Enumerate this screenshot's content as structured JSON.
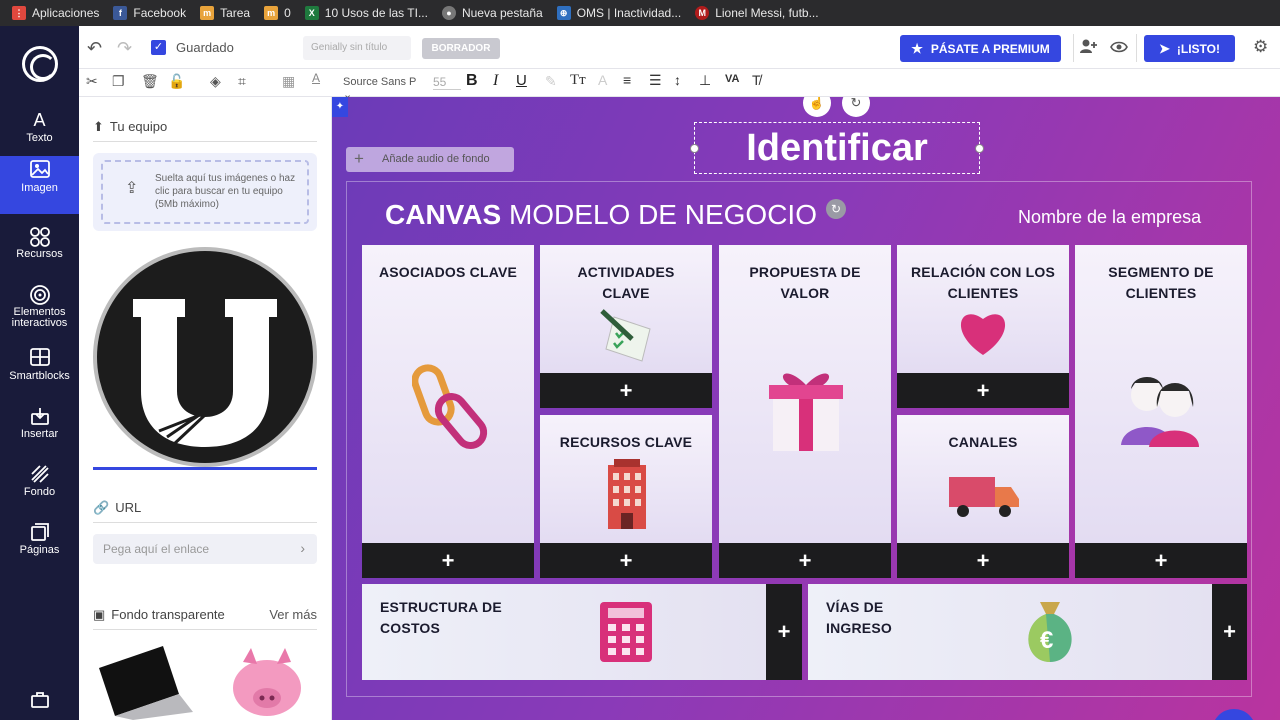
{
  "bookmarks": [
    {
      "label": "Aplicaciones",
      "color": "#e0483e"
    },
    {
      "label": "Facebook",
      "color": "#3b5998"
    },
    {
      "label": "Tarea",
      "color": "#e8a33b"
    },
    {
      "label": "0",
      "color": "#e8a33b"
    },
    {
      "label": "10 Usos de las TI...",
      "color": "#1f7a3e"
    },
    {
      "label": "Nueva pestaña",
      "color": "#777777"
    },
    {
      "label": "OMS | Inactividad...",
      "color": "#2f6fbf"
    },
    {
      "label": "Lionel Messi, futb...",
      "color": "#b01c1c"
    }
  ],
  "rail": {
    "items": [
      {
        "label": "Texto",
        "icon": "text-icon"
      },
      {
        "label": "Imagen",
        "icon": "image-icon"
      },
      {
        "label": "Recursos",
        "icon": "resources-icon"
      },
      {
        "label": "Elementos interactivos",
        "icon": "interactive-icon"
      },
      {
        "label": "Smartblocks",
        "icon": "smartblocks-icon"
      },
      {
        "label": "Insertar",
        "icon": "insert-icon"
      },
      {
        "label": "Fondo",
        "icon": "background-icon"
      },
      {
        "label": "Páginas",
        "icon": "pages-icon"
      }
    ],
    "active": "Imagen"
  },
  "topbar": {
    "saved_label": "Guardado",
    "title_placeholder": "Genially sin título",
    "draft_label": "BORRADOR",
    "premium_label": "PÁSATE A PREMIUM",
    "ready_label": "¡LISTO!"
  },
  "fmtbar": {
    "font_name": "Source Sans P",
    "font_size": "55"
  },
  "panel": {
    "team_title": "Tu equipo",
    "dropzone_text": "Suelta aquí tus imágenes o haz clic para buscar en tu equipo (5Mb máximo)",
    "url_title": "URL",
    "url_placeholder": "Pega aquí el enlace",
    "transparent_title": "Fondo transparente",
    "see_more": "Ver más"
  },
  "canvas": {
    "audio_label": "Añade audio de fondo",
    "heading": "Identificar",
    "canvas_title_bold": "CANVAS",
    "canvas_title_rest": "MODELO DE NEGOCIO",
    "company_name": "Nombre de la empresa",
    "plus": "+",
    "cards": {
      "asociados": "ASOCIADOS CLAVE",
      "actividades": "ACTIVIDADES CLAVE",
      "propuesta": "PROPUESTA DE VALOR",
      "relacion": "RELACIÓN CON LOS CLIENTES",
      "segmento": "SEGMENTO DE CLIENTES",
      "recursos": "RECURSOS CLAVE",
      "canales": "CANALES",
      "costos": "ESTRUCTURA DE COSTOS",
      "ingresos": "VÍAS DE INGRESO"
    }
  },
  "colors": {
    "accent": "#3547e0",
    "rail_bg": "#191b3a",
    "plus_bar": "#1c1c1e"
  }
}
